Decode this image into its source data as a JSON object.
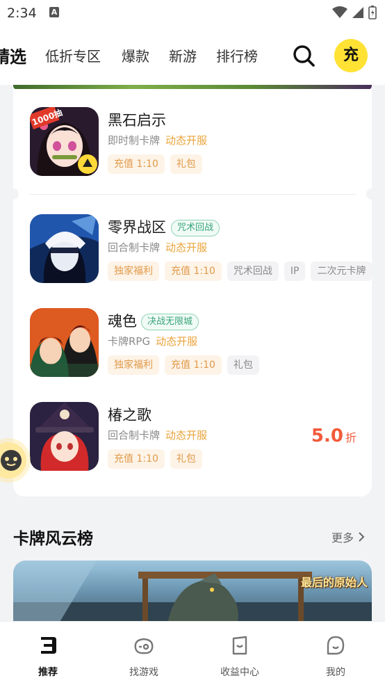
{
  "status_bar": {
    "time": "2:34",
    "notice_icon": "a-box-icon"
  },
  "top_nav": {
    "tabs": [
      {
        "label": "精选",
        "active": true
      },
      {
        "label": "低折专区",
        "active": false
      },
      {
        "label": "爆款",
        "active": false
      },
      {
        "label": "新游",
        "active": false
      },
      {
        "label": "排行榜",
        "active": false
      }
    ],
    "charge_label": "充"
  },
  "games": [
    {
      "name": "黑石启示",
      "badge": "",
      "type": "即时制卡牌",
      "open": "动态开服",
      "tags": [
        {
          "label": "充值 1:10",
          "style": "warm"
        },
        {
          "label": "礼包",
          "style": "warm"
        }
      ],
      "icon_badge": "1000抽"
    },
    {
      "name": "零界战区",
      "badge": "咒术回战",
      "type": "回合制卡牌",
      "open": "动态开服",
      "tags": [
        {
          "label": "独家福利",
          "style": "warm"
        },
        {
          "label": "充值 1:10",
          "style": "warm"
        },
        {
          "label": "咒术回战",
          "style": "gray"
        },
        {
          "label": "IP",
          "style": "gray"
        },
        {
          "label": "二次元卡牌",
          "style": "gray"
        }
      ]
    },
    {
      "name": "魂色",
      "badge": "决战无限城",
      "type": "卡牌RPG",
      "open": "动态开服",
      "tags": [
        {
          "label": "独家福利",
          "style": "warm"
        },
        {
          "label": "充值 1:10",
          "style": "warm"
        },
        {
          "label": "礼包",
          "style": "gray"
        }
      ]
    },
    {
      "name": "椿之歌",
      "badge": "",
      "type": "回合制卡牌",
      "open": "动态开服",
      "tags": [
        {
          "label": "充值 1:10",
          "style": "warm"
        },
        {
          "label": "礼包",
          "style": "warm"
        }
      ],
      "discount": "5.0",
      "discount_unit": "折"
    }
  ],
  "section": {
    "title": "卡牌风云榜",
    "more": "更多"
  },
  "banner": {
    "logo_text": "最后的原始人"
  },
  "bottom_nav": [
    {
      "label": "推荐",
      "icon": "recommend-icon",
      "active": true
    },
    {
      "label": "找游戏",
      "icon": "gamepad-icon",
      "active": false
    },
    {
      "label": "收益中心",
      "icon": "wallet-icon",
      "active": false
    },
    {
      "label": "我的",
      "icon": "profile-icon",
      "active": false
    }
  ],
  "colors": {
    "accent_yellow": "#ffe234",
    "discount_red": "#f25a3a",
    "open_orange": "#e9a33a",
    "badge_green": "#3aa57a"
  }
}
